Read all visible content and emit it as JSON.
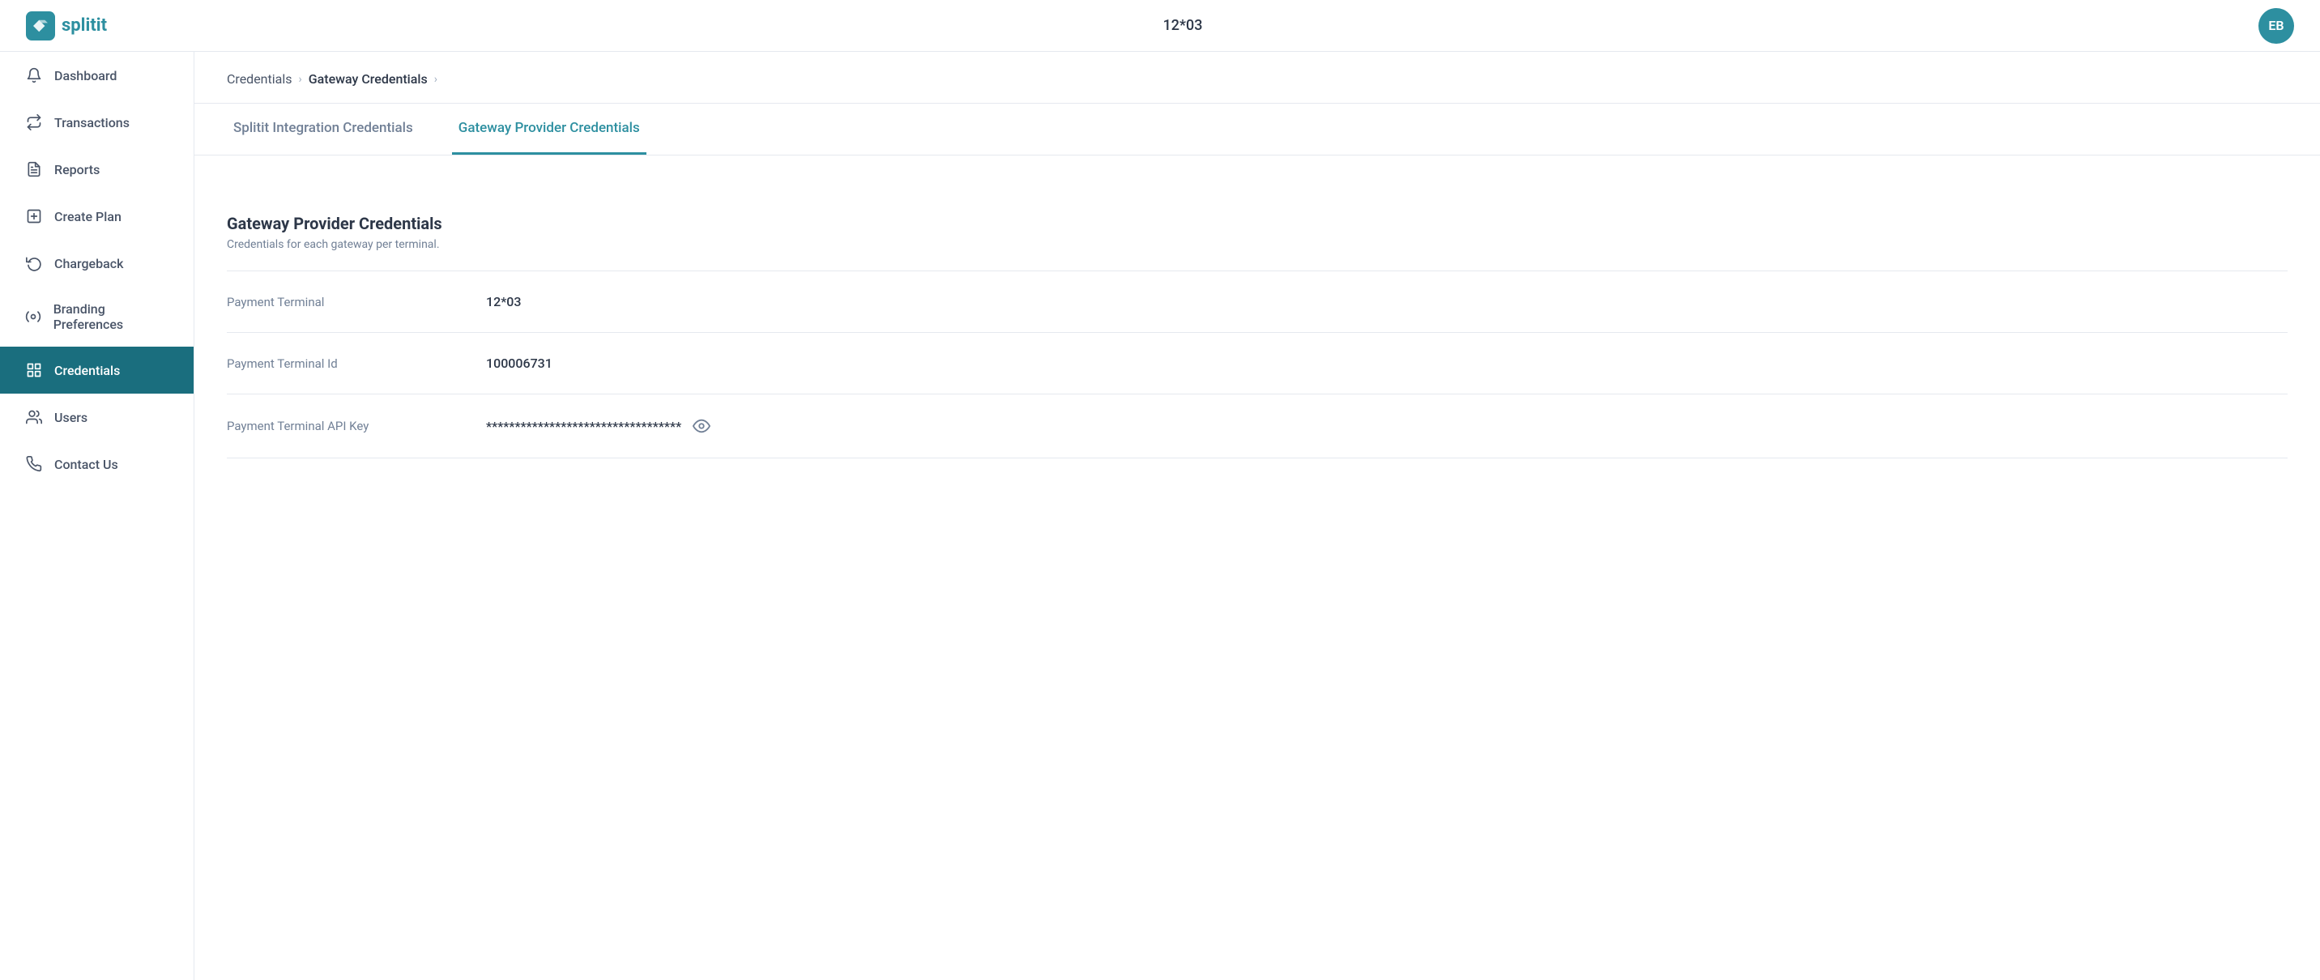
{
  "header": {
    "logo_text": "splitit",
    "center_text": "12*03",
    "avatar_initials": "EB"
  },
  "sidebar": {
    "items": [
      {
        "id": "dashboard",
        "label": "Dashboard",
        "icon": "bell"
      },
      {
        "id": "transactions",
        "label": "Transactions",
        "icon": "arrow"
      },
      {
        "id": "reports",
        "label": "Reports",
        "icon": "file"
      },
      {
        "id": "create-plan",
        "label": "Create Plan",
        "icon": "doc"
      },
      {
        "id": "chargeback",
        "label": "Chargeback",
        "icon": "refresh"
      },
      {
        "id": "branding",
        "label": "Branding Preferences",
        "icon": "settings"
      },
      {
        "id": "credentials",
        "label": "Credentials",
        "icon": "grid",
        "active": true
      },
      {
        "id": "users",
        "label": "Users",
        "icon": "user"
      },
      {
        "id": "contact",
        "label": "Contact Us",
        "icon": "phone"
      }
    ]
  },
  "breadcrumb": {
    "items": [
      {
        "label": "Credentials",
        "active": false
      },
      {
        "label": "Gateway Credentials",
        "active": true
      }
    ]
  },
  "tabs": [
    {
      "id": "splitit",
      "label": "Splitit Integration Credentials",
      "active": false
    },
    {
      "id": "gateway",
      "label": "Gateway Provider Credentials",
      "active": true
    }
  ],
  "section": {
    "title": "Gateway Provider Credentials",
    "subtitle": "Credentials for each gateway per terminal."
  },
  "credentials": [
    {
      "label": "Payment Terminal",
      "value": "12*03",
      "has_toggle": false
    },
    {
      "label": "Payment Terminal Id",
      "value": "100006731",
      "has_toggle": false
    },
    {
      "label": "Payment Terminal API Key",
      "value": "**********************************",
      "has_toggle": true
    }
  ]
}
